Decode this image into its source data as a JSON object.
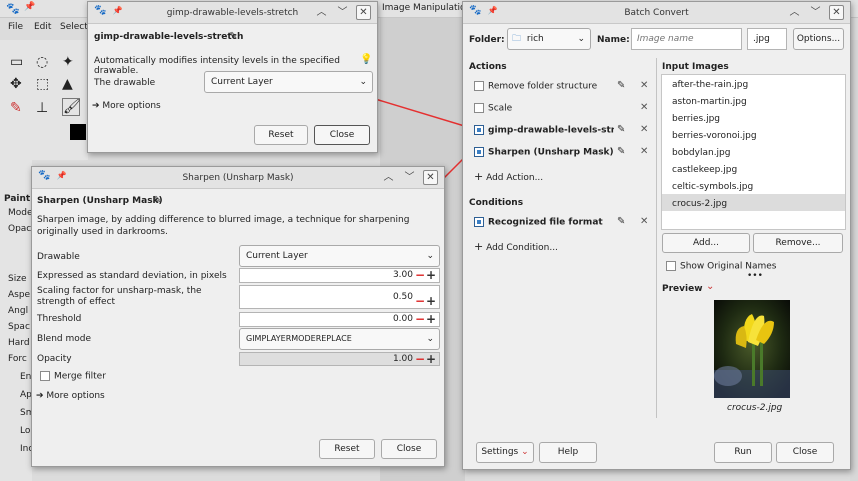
{
  "gimp_bg": {
    "menu": [
      "File",
      "Edit",
      "Select"
    ],
    "image_title": "Image Manipulation",
    "dock_labels": [
      "Paint",
      "Mode",
      "Opac",
      "Size",
      "Aspe",
      "Angl",
      "Spac",
      "Hard",
      "Forc",
      "En",
      "Ap",
      "Sm",
      "Lo",
      "Inc"
    ]
  },
  "levels_dialog": {
    "title": "gimp-drawable-levels-stretch",
    "heading": "gimp-drawable-levels-stretch",
    "description": "Automatically modifies intensity levels in the specified drawable.",
    "drawable_label": "The drawable",
    "drawable_value": "Current Layer",
    "more_options": "More options",
    "reset": "Reset",
    "close": "Close"
  },
  "sharpen_dialog": {
    "title": "Sharpen (Unsharp Mask)",
    "heading": "Sharpen (Unsharp Mask)",
    "description": "Sharpen image, by adding difference to blurred image, a technique for sharpening originally used in darkrooms.",
    "drawable_label": "Drawable",
    "drawable_value": "Current Layer",
    "std_dev_label": "Expressed as standard deviation, in pixels",
    "std_dev_value": "3.00",
    "scaling_label": "Scaling factor for unsharp-mask, the strength of effect",
    "scaling_value": "0.50",
    "threshold_label": "Threshold",
    "threshold_value": "0.00",
    "blend_label": "Blend mode",
    "blend_value": "GIMPLAYERMODEREPLACE",
    "opacity_label": "Opacity",
    "opacity_value": "1.00",
    "merge_filter": "Merge filter",
    "more_options": "More options",
    "reset": "Reset",
    "close": "Close"
  },
  "batch": {
    "title": "Batch Convert",
    "folder_label": "Folder:",
    "folder_value": "rich",
    "name_label": "Name:",
    "name_placeholder": "Image name",
    "ext_value": ".jpg",
    "options": "Options...",
    "actions_header": "Actions",
    "actions": [
      {
        "label": "Remove folder structure",
        "checked": false
      },
      {
        "label": "Scale",
        "checked": false
      },
      {
        "label": "gimp-drawable-levels-stret...",
        "checked": true
      },
      {
        "label": "Sharpen (Unsharp Mask)",
        "checked": true
      }
    ],
    "add_action": "Add Action...",
    "conditions_header": "Conditions",
    "conditions": [
      {
        "label": "Recognized file format",
        "checked": true
      }
    ],
    "add_condition": "Add Condition...",
    "input_header": "Input Images",
    "images": [
      "after-the-rain.jpg",
      "aston-martin.jpg",
      "berries.jpg",
      "berries-voronoi.jpg",
      "bobdylan.jpg",
      "castlekeep.jpg",
      "celtic-symbols.jpg",
      "crocus-2.jpg"
    ],
    "selected_image": "crocus-2.jpg",
    "add": "Add...",
    "remove": "Remove...",
    "show_original": "Show Original Names",
    "preview_label": "Preview",
    "preview_caption": "crocus-2.jpg",
    "settings": "Settings",
    "help": "Help",
    "run": "Run",
    "close": "Close"
  }
}
